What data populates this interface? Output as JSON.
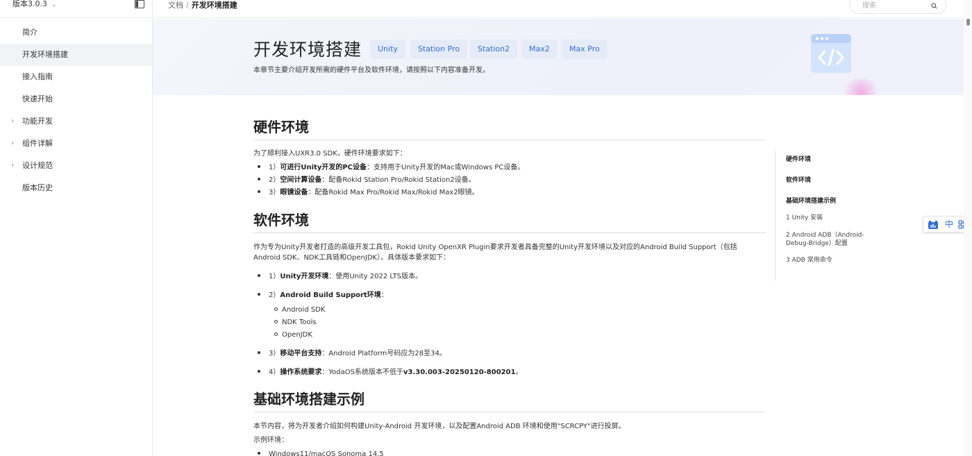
{
  "sidebar": {
    "version": "版本3.0.3",
    "items": [
      {
        "label": "简介"
      },
      {
        "label": "开发环境搭建"
      },
      {
        "label": "接入指南"
      },
      {
        "label": "快速开始"
      },
      {
        "label": "功能开发"
      },
      {
        "label": "组件详解"
      },
      {
        "label": "设计规范"
      },
      {
        "label": "版本历史"
      }
    ]
  },
  "breadcrumb": {
    "root": "文档",
    "separator": "/",
    "current": "开发环境搭建"
  },
  "search": {
    "placeholder": "搜索"
  },
  "hero": {
    "title": "开发环境搭建",
    "tags": [
      "Unity",
      "Station Pro",
      "Station2",
      "Max2",
      "Max Pro"
    ],
    "subtitle": "本章节主要介绍开发所需的硬件平台及软件环境，请按照以下内容准备开发。"
  },
  "hardware": {
    "heading": "硬件环境",
    "intro": "为了顺利接入UXR3.0 SDK，硬件环境要求如下：",
    "items": [
      {
        "num": "1）",
        "bold": "可进行Unity开发的PC设备",
        "text": "：支持用于Unity开发的Mac或Windows PC设备。"
      },
      {
        "num": "2）",
        "bold": "空间计算设备",
        "text": "：配备Rokid Station Pro/Rokid Station2设备。"
      },
      {
        "num": "3）",
        "bold": "眼镜设备",
        "text": "：配备Rokid Max Pro/Rokid Max/Rokid Max2眼镜。"
      }
    ]
  },
  "software": {
    "heading": "软件环境",
    "intro": "作为专为Unity开发者打造的高级开发工具包，Rokid Unity OpenXR Plugin要求开发者具备完整的Unity开发环境以及对应的Android Build Support（包括Android SDK、NDK工具链和OpenJDK）。具体版本要求如下：",
    "items": [
      {
        "num": "1）",
        "bold": "Unity开发环境",
        "text": "：使用Unity 2022 LTS版本。"
      },
      {
        "num": "2）",
        "bold": "Android Build Support环境",
        "text": "："
      },
      {
        "num": "3）",
        "bold": "移动平台支持",
        "text": "：Android Platform号码应为28至34。"
      },
      {
        "num": "4）",
        "bold": "操作系统要求",
        "text": "：YodaOS系统版本不低于",
        "tail": "v3.30.003-20250120-800201",
        "end": "。"
      }
    ],
    "subitems": [
      "Android SDK",
      "NDK Tools",
      "OpenJDK"
    ]
  },
  "example": {
    "heading": "基础环境搭建示例",
    "intro": "本节内容，将为开发者介绍如何构建Unity-Android 开发环境，以及配置Android ADB 环境和使用\"SCRCPY\"进行投屏。",
    "env_label": "示例环境：",
    "env_first": "Windows11/macOS Sonoma 14.5"
  },
  "toc": {
    "items": [
      {
        "label": "硬件环境"
      },
      {
        "label": "软件环境"
      },
      {
        "label": "基础环境搭建示例"
      },
      {
        "label": "1 Unity 安装"
      },
      {
        "label": "2 Android ADB（Android-Debug-Bridge）配置"
      },
      {
        "label": "3 ADB 常用命令"
      }
    ]
  },
  "widget": {
    "lang": "中"
  },
  "colors": {
    "accent": "#2f6fd8",
    "tag_bg": "#e6ebf8",
    "active_bg": "#f2f3f5"
  }
}
